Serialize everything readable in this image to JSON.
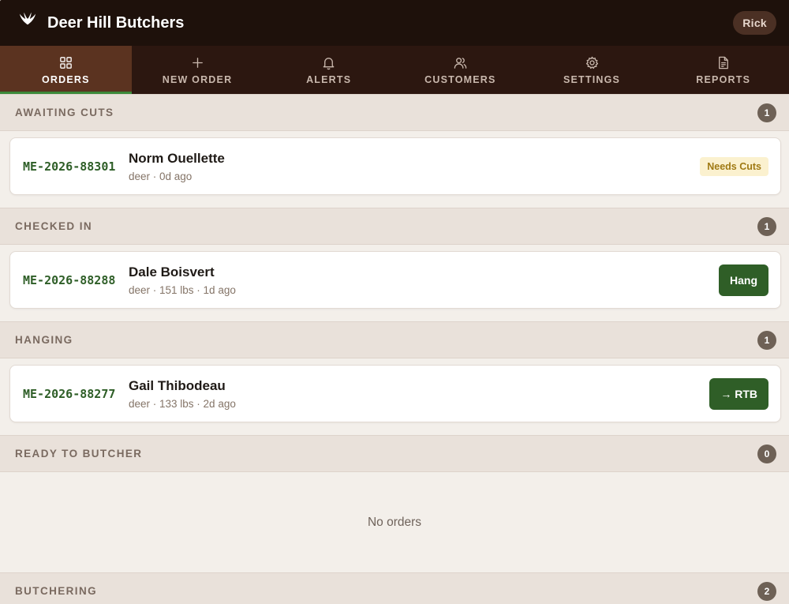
{
  "app": {
    "title": "Deer Hill Butchers",
    "user": "Rick"
  },
  "tabs": [
    {
      "label": "ORDERS",
      "icon": "grid-icon",
      "active": true
    },
    {
      "label": "NEW ORDER",
      "icon": "plus-icon"
    },
    {
      "label": "ALERTS",
      "icon": "bell-icon"
    },
    {
      "label": "CUSTOMERS",
      "icon": "users-icon"
    },
    {
      "label": "SETTINGS",
      "icon": "gear-icon"
    },
    {
      "label": "REPORTS",
      "icon": "document-icon"
    }
  ],
  "sections": {
    "awaiting_cuts": {
      "title": "AWAITING CUTS",
      "count": "1",
      "orders": [
        {
          "id": "ME-2026-88301",
          "name": "Norm Ouellette",
          "meta": "deer · 0d ago",
          "status": "Needs Cuts"
        }
      ]
    },
    "checked_in": {
      "title": "CHECKED IN",
      "count": "1",
      "orders": [
        {
          "id": "ME-2026-88288",
          "name": "Dale Boisvert",
          "meta": "deer · 151 lbs · 1d ago",
          "action": "Hang"
        }
      ]
    },
    "hanging": {
      "title": "HANGING",
      "count": "1",
      "orders": [
        {
          "id": "ME-2026-88277",
          "name": "Gail Thibodeau",
          "meta": "deer · 133 lbs · 2d ago",
          "action": "→ RTB"
        }
      ]
    },
    "ready_to_butcher": {
      "title": "READY TO BUTCHER",
      "count": "0",
      "empty_text": "No orders"
    },
    "butchering": {
      "title": "BUTCHERING",
      "count": "2"
    }
  },
  "colors": {
    "header_bg": "#1e110b",
    "tabbar_bg": "#2c1710",
    "tab_active_bg": "#5b3320",
    "tab_active_indicator": "#3c8a3a",
    "order_id": "#2e5e27",
    "action_button": "#2f5e27",
    "status_pill_bg": "#fbf1cf",
    "status_pill_text": "#a07a14"
  }
}
